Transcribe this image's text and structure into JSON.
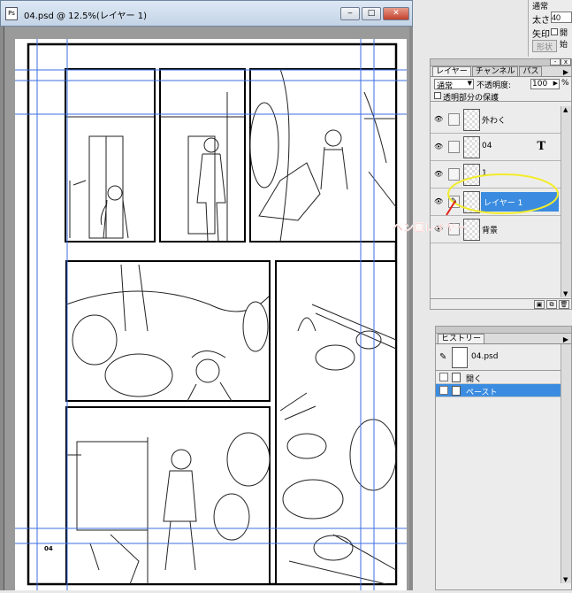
{
  "window": {
    "title": "04.psd @ 12.5%(レイヤー 1)",
    "min": "‒",
    "max": "□",
    "close": "✕"
  },
  "page": {
    "page_number": "04"
  },
  "tool_options": {
    "row1": "通常",
    "size_label": "太さ",
    "size_value": "40",
    "arrow_label": "矢印",
    "arrow_value": "開始",
    "shape_button": "形状"
  },
  "layers_panel": {
    "tabs": [
      "レイヤー",
      "チャンネル",
      "パス"
    ],
    "blend_mode": "通常",
    "opacity_label": "不透明度:",
    "opacity_value": "100",
    "opacity_unit": "%",
    "protect_label": "透明部分の保護",
    "layers": [
      {
        "name": "外わく",
        "type": "raster",
        "selected": false
      },
      {
        "name": "04",
        "type": "text",
        "icon": "T",
        "selected": false
      },
      {
        "name": "1",
        "type": "raster",
        "selected": false
      },
      {
        "name": "レイヤー 1",
        "type": "raster",
        "selected": true
      },
      {
        "name": "背景",
        "type": "raster",
        "selected": false
      }
    ]
  },
  "annotation": {
    "text": "ペン画レイヤー",
    "color": "#e0241b",
    "highlight_color": "#f2ec2a"
  },
  "history_panel": {
    "tab": "ヒストリー",
    "snapshot": "04.psd",
    "items": [
      {
        "name": "開く",
        "selected": false
      },
      {
        "name": "ペースト",
        "selected": true
      }
    ]
  },
  "colors": {
    "selection": "#3b8ce0",
    "guide": "#3d6de0"
  }
}
